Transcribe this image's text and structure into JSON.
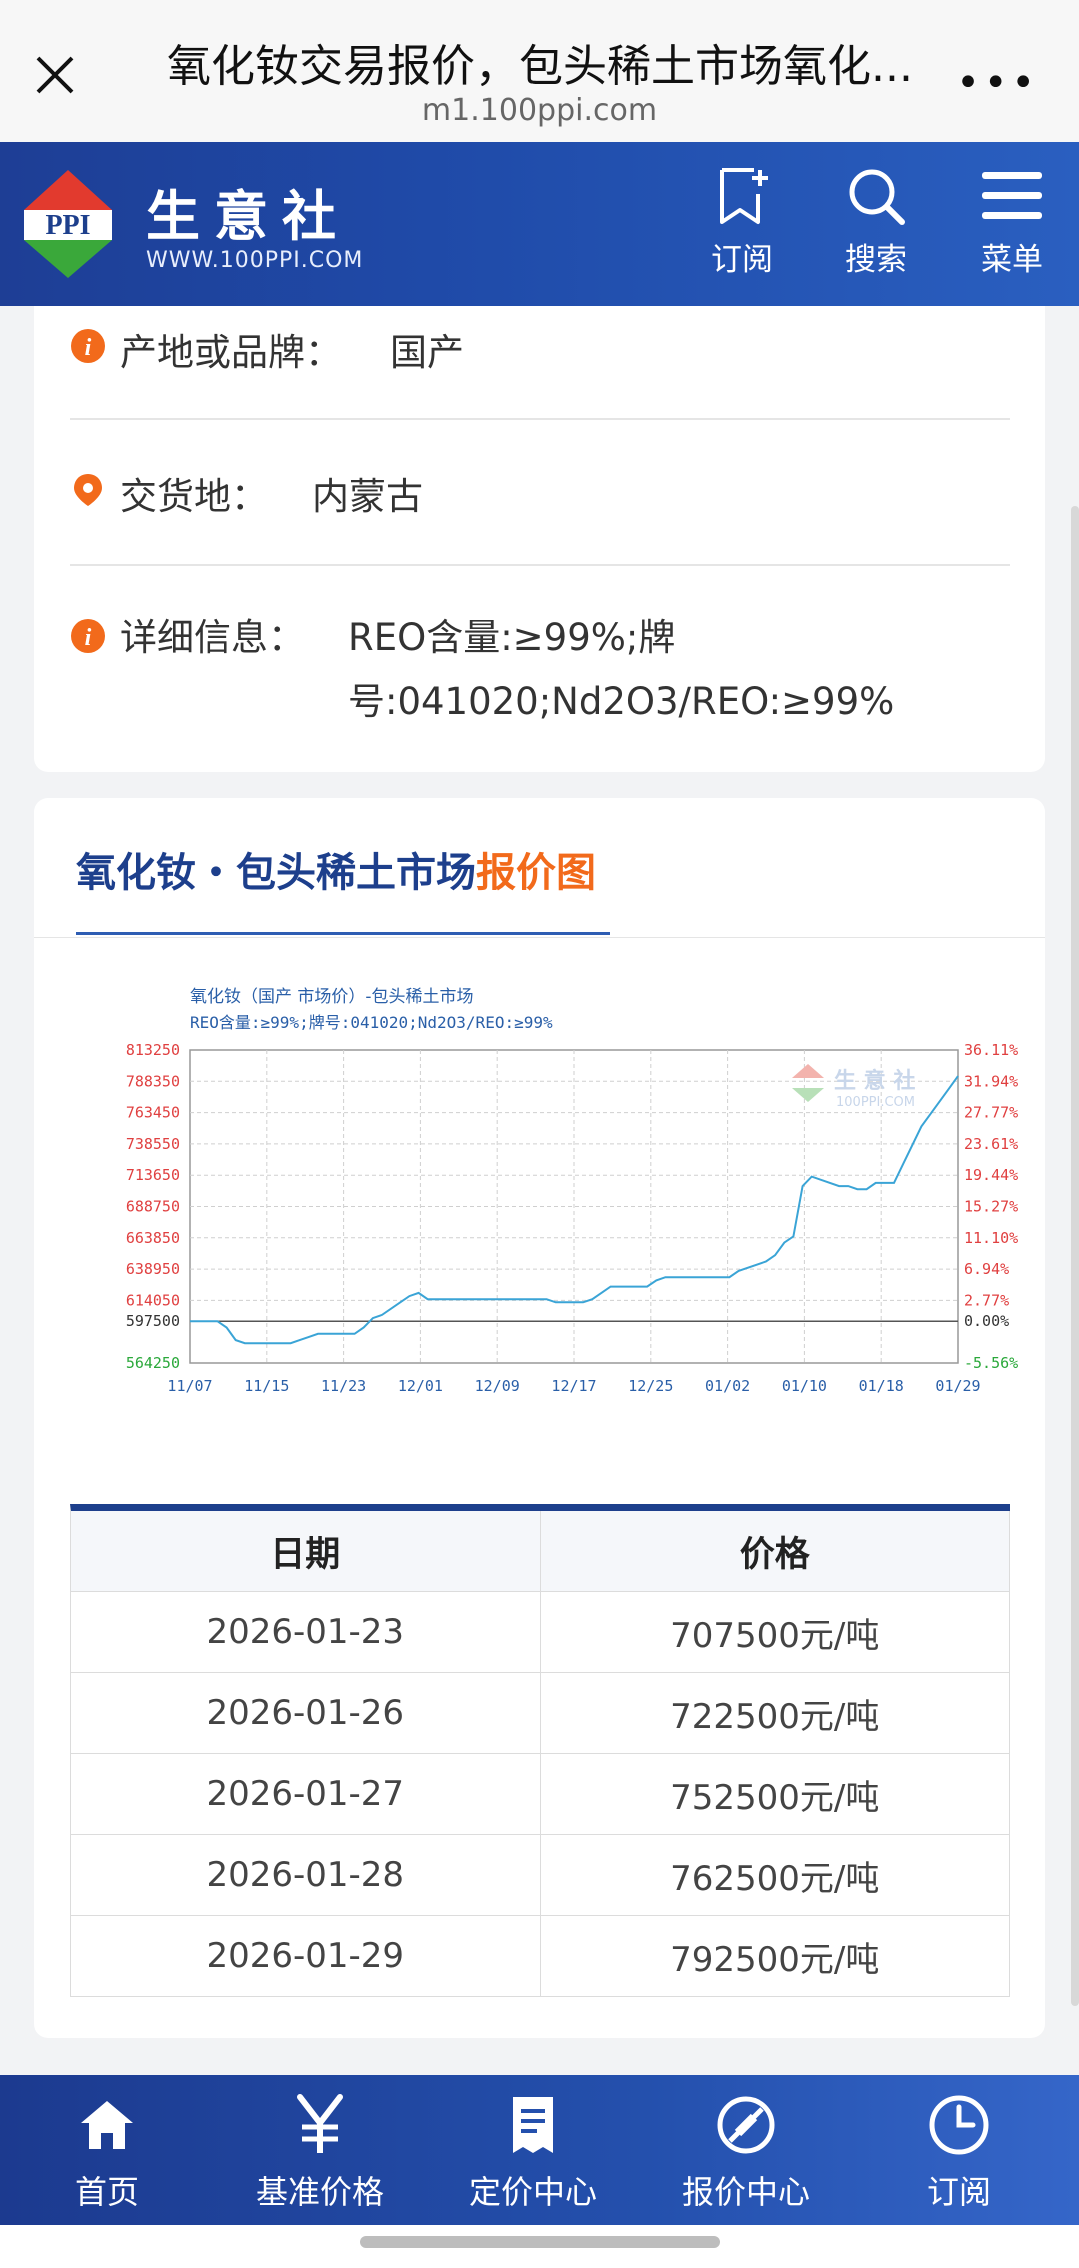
{
  "browser": {
    "title": "氧化钕交易报价，包头稀土市场氧化...",
    "url": "m1.100ppi.com"
  },
  "header": {
    "logo_text": "PPI",
    "brand": "生意社",
    "brand_url": "WWW.100PPI.COM",
    "subscribe": "订阅",
    "search": "搜索",
    "menu": "菜单"
  },
  "info": {
    "origin_label": "产地或品牌：",
    "origin_value": "国产",
    "delivery_label": "交货地：",
    "delivery_value": "内蒙古",
    "detail_label": "详细信息：",
    "detail_value": "REO含量:≥99%;牌号:041020;Nd2O3/REO:≥99%"
  },
  "section": {
    "title_main": "氧化钕・包头稀土市场",
    "title_highlight": "报价图"
  },
  "chart_data": {
    "type": "line",
    "title": "氧化钕（国产 市场价）-包头稀土市场",
    "subtitle": "REO含量:≥99%;牌号:041020;Nd2O3/REO:≥99%",
    "watermark": "生 意 社",
    "watermark_url": "100PPI.COM",
    "x_ticks": [
      "11/07",
      "11/15",
      "11/23",
      "12/01",
      "12/09",
      "12/17",
      "12/25",
      "01/02",
      "01/10",
      "01/18",
      "01/29"
    ],
    "y_ticks": [
      813250,
      788350,
      763450,
      738550,
      713650,
      688750,
      663850,
      638950,
      614050,
      597500,
      564250
    ],
    "y2_ticks": [
      "36.11%",
      "31.94%",
      "27.77%",
      "23.61%",
      "19.44%",
      "15.27%",
      "11.10%",
      "6.94%",
      "2.77%",
      "0.00%",
      "-5.56%"
    ],
    "ylim": [
      564250,
      813250
    ],
    "baseline": 597500,
    "x": [
      0,
      3,
      4,
      5,
      6,
      11,
      12,
      13,
      14,
      18,
      19,
      20,
      21,
      23,
      24,
      25,
      26,
      39,
      40,
      43,
      44,
      45,
      46,
      50,
      51,
      52,
      53,
      59,
      60,
      63,
      64,
      65,
      66,
      67,
      68,
      71,
      72,
      73,
      74,
      75,
      76,
      77,
      78,
      80,
      81,
      83,
      84
    ],
    "values": [
      597500,
      597500,
      592500,
      582500,
      580000,
      580000,
      582500,
      585000,
      587500,
      587500,
      592500,
      600000,
      602500,
      612500,
      617500,
      620000,
      615000,
      615000,
      612500,
      612500,
      615000,
      620000,
      625000,
      625000,
      630000,
      632500,
      632500,
      632500,
      637500,
      645000,
      650000,
      660000,
      665000,
      705000,
      712500,
      705000,
      705000,
      702500,
      702500,
      707500,
      707500,
      707500,
      722500,
      752500,
      762500,
      782500,
      792500
    ]
  },
  "table": {
    "headers": [
      "日期",
      "价格"
    ],
    "rows": [
      [
        "2026-01-23",
        "707500元/吨"
      ],
      [
        "2026-01-26",
        "722500元/吨"
      ],
      [
        "2026-01-27",
        "752500元/吨"
      ],
      [
        "2026-01-28",
        "762500元/吨"
      ],
      [
        "2026-01-29",
        "792500元/吨"
      ]
    ]
  },
  "nav": {
    "home": "首页",
    "benchmark": "基准价格",
    "pricing": "定价中心",
    "quote": "报价中心",
    "subscribe": "订阅"
  },
  "colors": {
    "brand_blue": "#1d3f8c",
    "accent_orange": "#f26a1b",
    "chart_line": "#3aa4d6",
    "axis_red": "#e04040",
    "axis_green": "#2aa83a"
  }
}
